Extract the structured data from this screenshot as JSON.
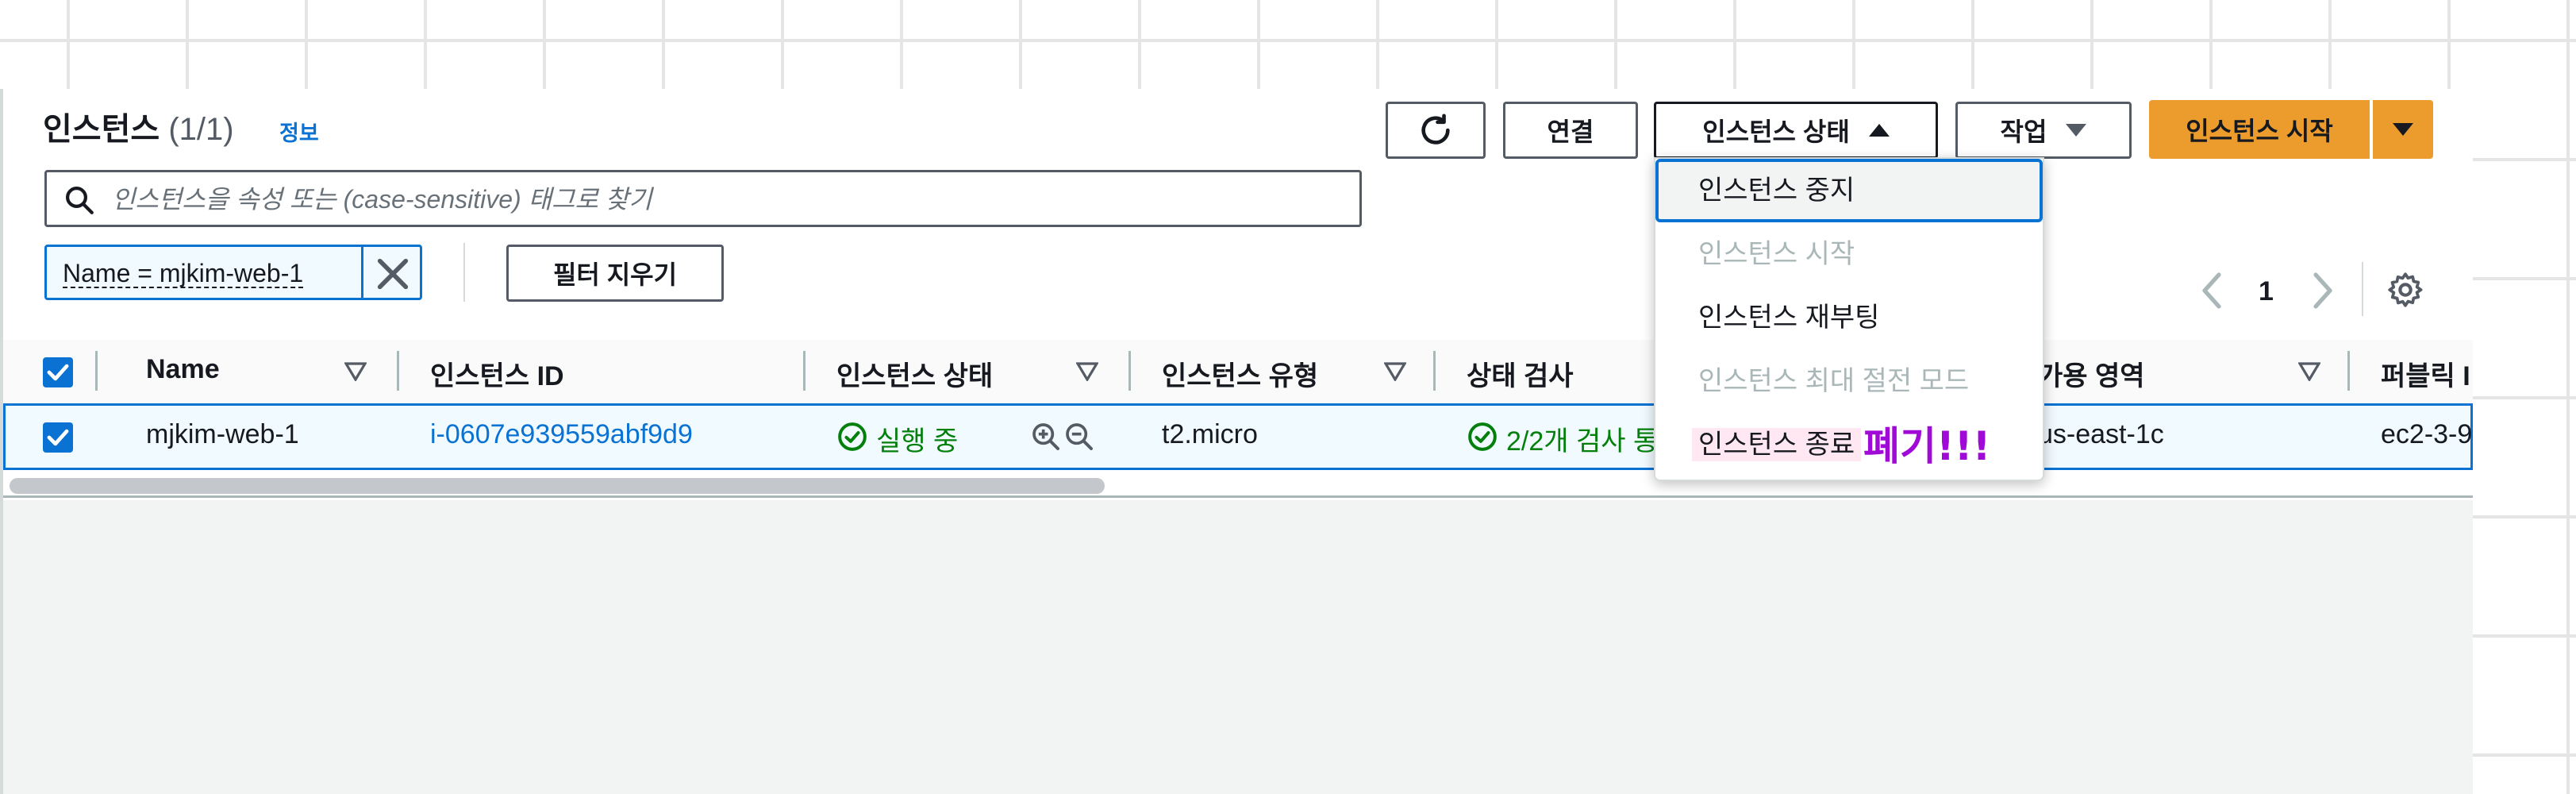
{
  "header": {
    "title": "인스턴스",
    "count": "(1/1)",
    "info_link": "정보"
  },
  "toolbar": {
    "refresh_icon": "refresh-icon",
    "connect_label": "연결",
    "instance_state_label": "인스턴스 상태",
    "actions_label": "작업",
    "launch_label": "인스턴스 시작"
  },
  "search": {
    "placeholder": "인스턴스을 속성 또는 (case-sensitive) 태그로 찾기",
    "value": ""
  },
  "filter": {
    "token": "Name = mjkim-web-1",
    "clear_label": "필터 지우기"
  },
  "pagination": {
    "page": "1"
  },
  "table": {
    "columns": [
      "Name",
      "인스턴스 ID",
      "인스턴스 상태",
      "인스턴스 유형",
      "상태 검사",
      "가용 영역",
      "퍼블릭 I"
    ],
    "rows": [
      {
        "name": "mjkim-web-1",
        "instance_id": "i-0607e939559abf9d9",
        "state": "실행 중",
        "type": "t2.micro",
        "status_check": "2/2개 검사 통",
        "az": "us-east-1c",
        "public": "ec2-3-9"
      }
    ]
  },
  "state_menu": {
    "items": [
      "인스턴스 중지",
      "인스턴스 시작",
      "인스턴스 재부팅",
      "인스턴스 최대 절전 모드",
      "인스턴스 종료"
    ],
    "annotation": "폐기!!!"
  },
  "colors": {
    "primary": "#ec9c2c",
    "link": "#0972d3",
    "success": "#037f0c",
    "annotation": "#a00ad6"
  }
}
